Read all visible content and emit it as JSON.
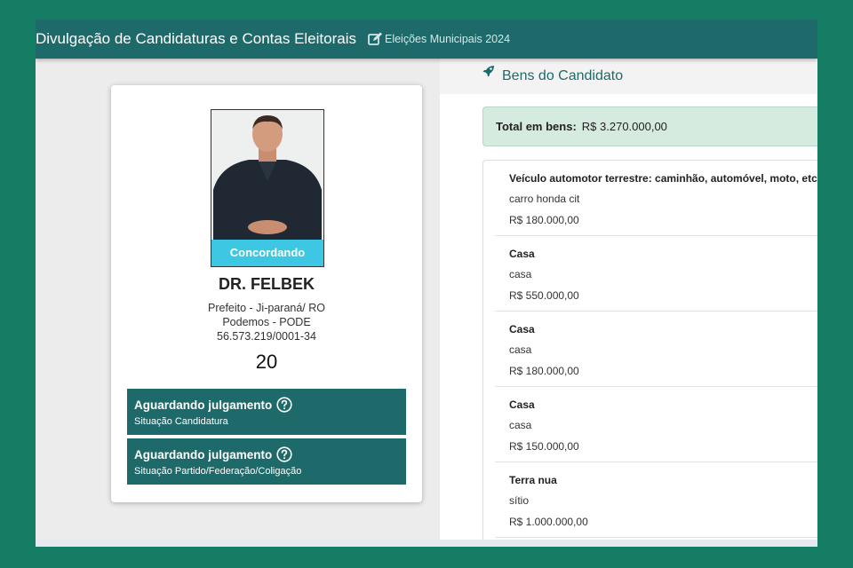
{
  "header": {
    "title": "Divulgação de Candidaturas e Contas Eleitorais",
    "subtitle": "Eleições Municipais 2024"
  },
  "candidate": {
    "photo_banner": "Concordando",
    "name": "DR. FELBEK",
    "office": "Prefeito - Ji-paraná/ RO",
    "party": "Podemos - PODE",
    "cnpj": "56.573.219/0001-34",
    "number": "20",
    "status": [
      {
        "title": "Aguardando julgamento",
        "subtitle": "Situação Candidatura"
      },
      {
        "title": "Aguardando julgamento",
        "subtitle": "Situação Partido/Federação/Coligação"
      }
    ]
  },
  "assets": {
    "heading": "Bens do Candidato",
    "total_label": "Total em bens:",
    "total_value": "R$ 3.270.000,00",
    "items": [
      {
        "type": "Veículo automotor terrestre: caminhão, automóvel, moto, etc.",
        "description": "carro honda cit",
        "value": "R$ 180.000,00"
      },
      {
        "type": "Casa",
        "description": "casa",
        "value": "R$ 550.000,00"
      },
      {
        "type": "Casa",
        "description": "casa",
        "value": "R$ 180.000,00"
      },
      {
        "type": "Casa",
        "description": "casa",
        "value": "R$ 150.000,00"
      },
      {
        "type": "Terra nua",
        "description": "sítio",
        "value": "R$ 1.000.000,00"
      }
    ]
  },
  "colors": {
    "outer_background": "#157d63",
    "primary": "#1e6a6b",
    "banner": "#3ec7e3",
    "total_background": "#d6ebe0"
  },
  "icons": {
    "edit": "edit-icon",
    "help": "question-circle-icon",
    "rocket": "rocket-icon"
  }
}
